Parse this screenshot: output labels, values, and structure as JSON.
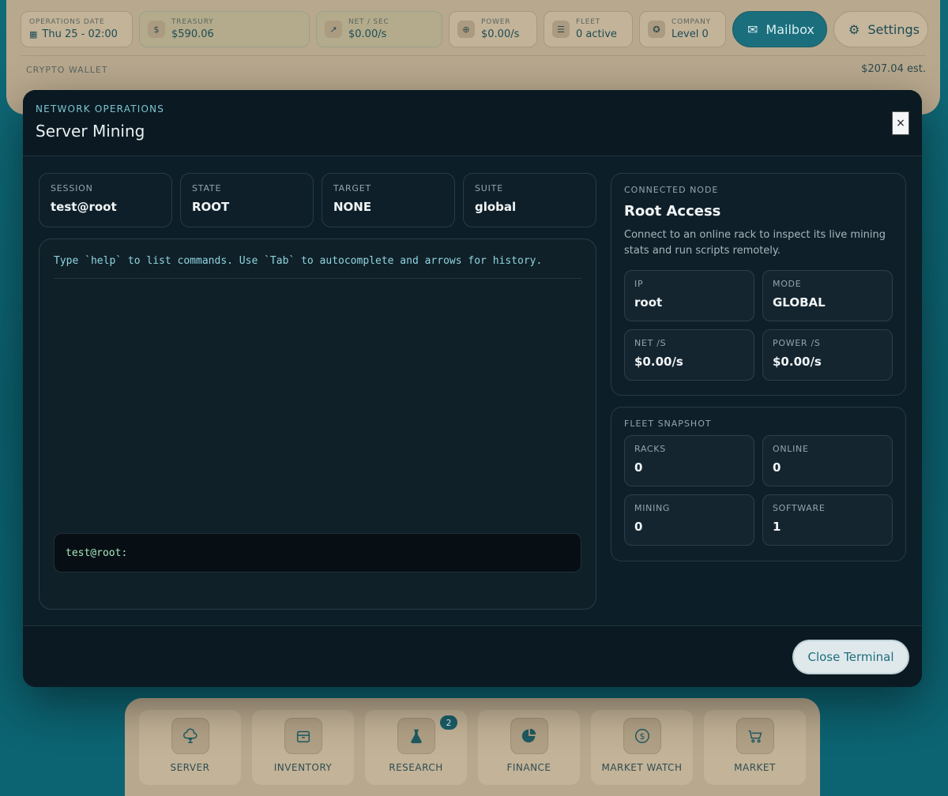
{
  "topbar": {
    "stats": [
      {
        "label": "OPERATIONS DATE",
        "value": "Thu 25 - 02:00",
        "icon": "calendar-icon"
      },
      {
        "label": "TREASURY",
        "value": "$590.06",
        "icon": "dollar-icon"
      },
      {
        "label": "NET / SEC",
        "value": "$0.00/s",
        "icon": "trend-up-icon"
      },
      {
        "label": "POWER",
        "value": "$0.00/s",
        "icon": "power-icon"
      },
      {
        "label": "FLEET",
        "value": "0 active",
        "icon": "server-icon"
      },
      {
        "label": "COMPANY",
        "value": "Level 0",
        "icon": "medal-icon"
      }
    ],
    "mailbox_label": "Mailbox",
    "settings_label": "Settings",
    "wallet_label": "CRYPTO WALLET",
    "wallet_value": "$207.04 est."
  },
  "modal": {
    "eyebrow": "NETWORK OPERATIONS",
    "title": "Server Mining",
    "close_symbol": "×",
    "info": [
      {
        "label": "SESSION",
        "value": "test@root"
      },
      {
        "label": "STATE",
        "value": "ROOT"
      },
      {
        "label": "TARGET",
        "value": "NONE"
      },
      {
        "label": "SUITE",
        "value": "global"
      }
    ],
    "terminal": {
      "hint": "Type `help` to list commands.  Use `Tab` to autocomplete and arrows for history.",
      "prompt": "test@root:"
    },
    "node": {
      "eyebrow": "CONNECTED NODE",
      "title": "Root Access",
      "description": "Connect to an online rack to inspect its live mining stats and run scripts remotely.",
      "stats": [
        {
          "label": "IP",
          "value": "root"
        },
        {
          "label": "MODE",
          "value": "GLOBAL"
        },
        {
          "label": "NET /S",
          "value": "$0.00/s"
        },
        {
          "label": "POWER /S",
          "value": "$0.00/s"
        }
      ]
    },
    "fleet": {
      "eyebrow": "FLEET SNAPSHOT",
      "stats": [
        {
          "label": "RACKS",
          "value": "0"
        },
        {
          "label": "ONLINE",
          "value": "0"
        },
        {
          "label": "MINING",
          "value": "0"
        },
        {
          "label": "SOFTWARE",
          "value": "1"
        }
      ]
    },
    "close_terminal_label": "Close Terminal"
  },
  "bottom_nav": [
    {
      "label": "SERVER",
      "icon": "cloud-tree-icon"
    },
    {
      "label": "INVENTORY",
      "icon": "box-icon"
    },
    {
      "label": "RESEARCH",
      "icon": "flask-icon",
      "badge": "2"
    },
    {
      "label": "FINANCE",
      "icon": "pie-chart-icon"
    },
    {
      "label": "MARKET WATCH",
      "icon": "coin-icon"
    },
    {
      "label": "MARKET",
      "icon": "cart-icon"
    }
  ]
}
